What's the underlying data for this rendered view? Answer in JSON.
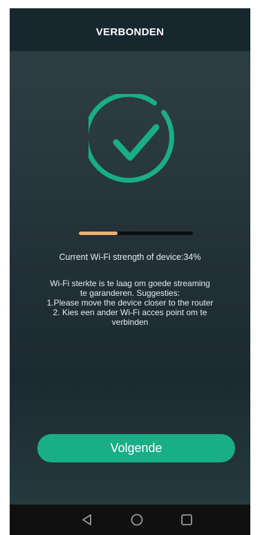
{
  "header": {
    "title": "VERBONDEN"
  },
  "status": {
    "icon": "check-circle-icon",
    "accent_color": "#1aae85"
  },
  "signal": {
    "strength_fraction": 0.34,
    "fill_color": "#f0b074",
    "label": "Current Wi-Fi strength of device:34%"
  },
  "message": {
    "lines": [
      "Wi-Fi sterkte is te laag om goede streaming",
      "te garanderen. Suggesties:",
      "1.Please move the device closer to the router",
      "2. Kies een ander Wi-Fi acces point om te",
      "verbinden"
    ]
  },
  "actions": {
    "next_label": "Volgende",
    "button_color": "#1aae85"
  },
  "navigation_bar": {
    "icons": [
      "back-triangle-icon",
      "home-circle-icon",
      "recents-square-icon"
    ]
  }
}
